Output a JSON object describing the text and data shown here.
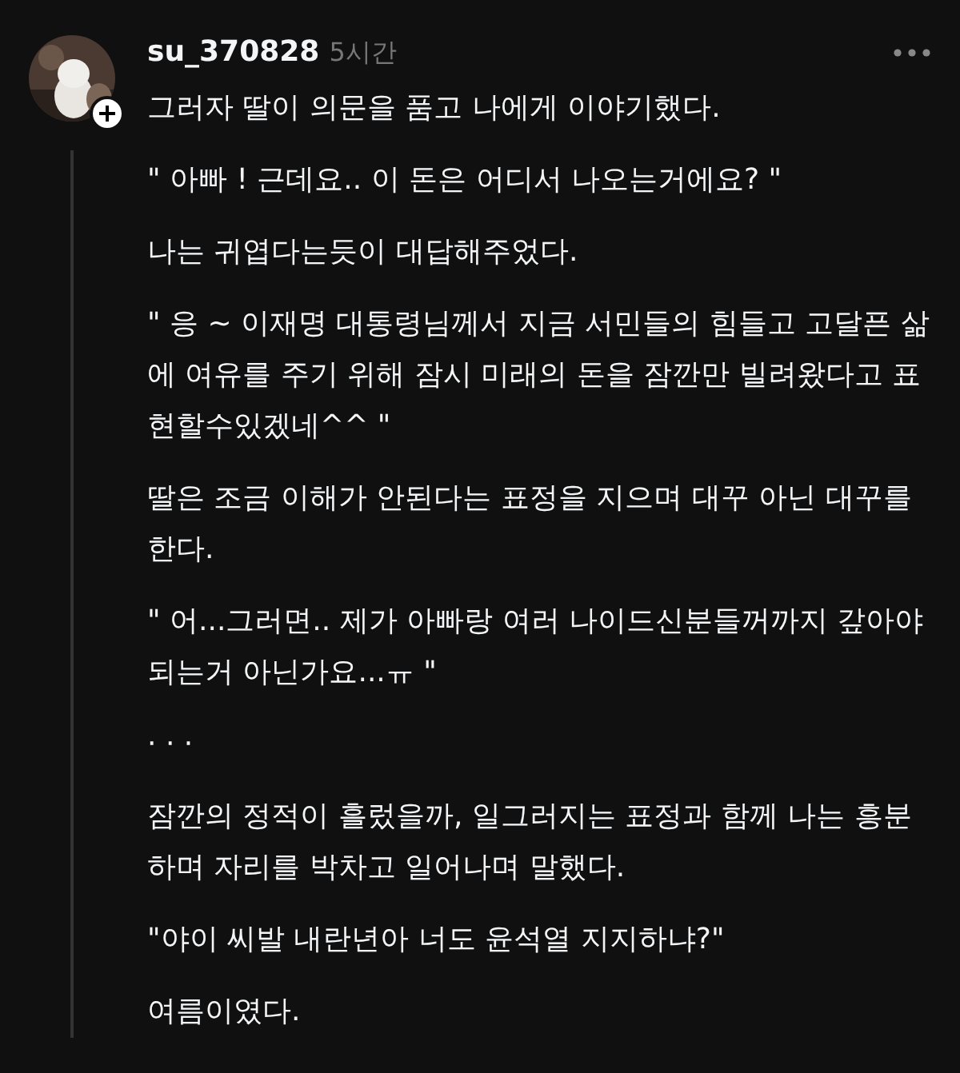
{
  "post": {
    "author": {
      "username": "su_370828",
      "time": "5시간"
    },
    "paragraphs": [
      "그러자 딸이 의문을 품고 나에게 이야기했다.",
      "\" 아빠 ! 근데요.. 이 돈은 어디서 나오는거에요? \"",
      "나는 귀엽다는듯이 대답해주었다.",
      "\" 응 ~ 이재명 대통령님께서 지금 서민들의 힘들고 고달픈 삶에 여유를 주기 위해 잠시 미래의 돈을 잠깐만 빌려왔다고 표현할수있겠네^^ \"",
      "딸은 조금 이해가 안된다는 표정을 지으며 대꾸 아닌 대꾸를 한다.",
      "\" 어...그러면.. 제가 아빠랑 여러 나이드신분들꺼까지 갚아야되는거 아닌가요...ㅠ \"",
      "· · ·",
      "잠깐의 정적이 흘렀을까, 일그러지는 표정과 함께 나는 흥분하며 자리를 박차고 일어나며 말했다.",
      "\"야이 씨발 내란년아 너도 윤석열 지지하냐?\"",
      "여름이였다."
    ]
  }
}
